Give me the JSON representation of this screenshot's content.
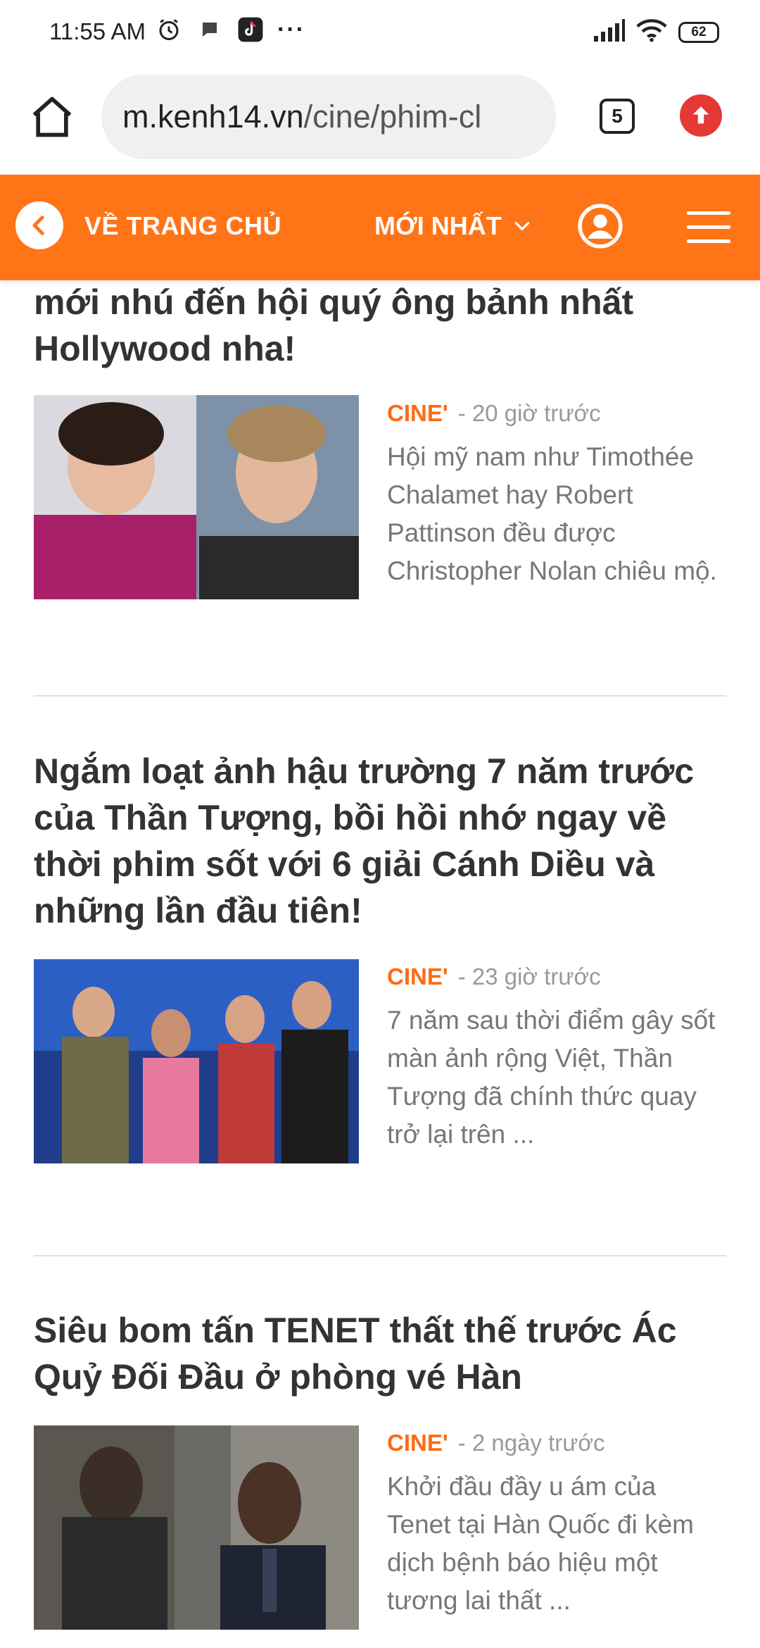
{
  "status_bar": {
    "time": "11:55 AM",
    "more": "···",
    "battery": "62"
  },
  "browser": {
    "url_host": "m.kenh14.vn",
    "url_path": "/cine/phim-cl",
    "tab_count": "5"
  },
  "site_header": {
    "home_link": "VỀ TRANG CHỦ",
    "latest_label": "MỚI NHẤT"
  },
  "articles": [
    {
      "title": "mới nhú đến hội quý ông bảnh nhất Hollywood nha!",
      "category": "CINE'",
      "time": "- 20 giờ trước",
      "excerpt": "Hội mỹ nam như Timothée Chalamet hay Robert Pattinson đều được Christopher Nolan chiêu mộ."
    },
    {
      "title": "Ngắm loạt ảnh hậu trường 7 năm trước của Thần Tượng, bồi hồi nhớ ngay về thời phim sốt với 6 giải Cánh Diều và những lần đầu tiên!",
      "category": "CINE'",
      "time": "- 23 giờ trước",
      "excerpt": "7 năm sau thời điểm gây sốt màn ảnh rộng Việt, Thần Tượng đã chính thức quay trở lại trên ..."
    },
    {
      "title": "Siêu bom tấn TENET thất thế trước Ác Quỷ Đối Đầu ở phòng vé Hàn",
      "category": "CINE'",
      "time": "- 2 ngày trước",
      "excerpt": "Khởi đầu đầy u ám của Tenet tại Hàn Quốc đi kèm dịch bệnh báo hiệu một tương lai thất ..."
    }
  ]
}
